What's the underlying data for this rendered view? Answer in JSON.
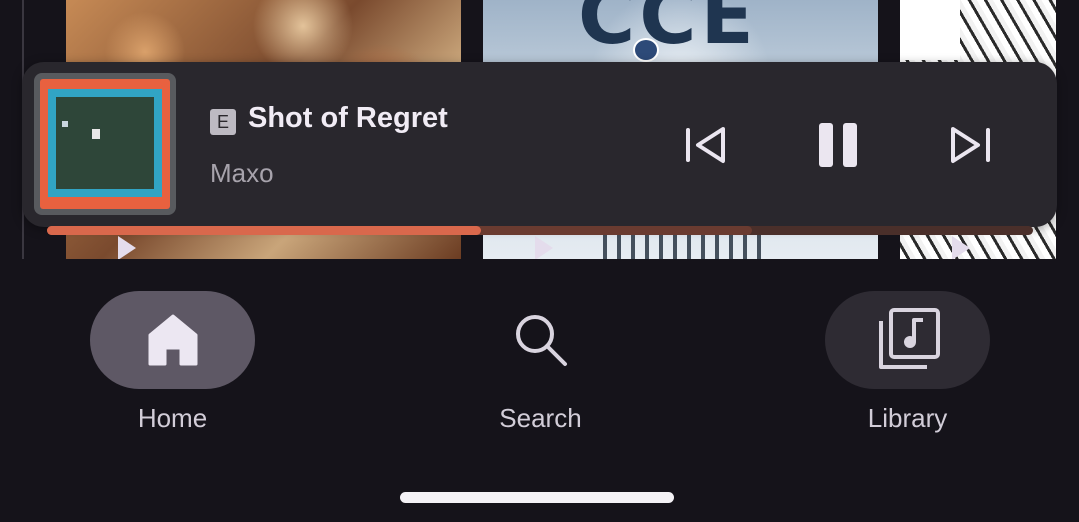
{
  "now_playing": {
    "explicit_badge": "E",
    "title": "Shot of Regret",
    "artist": "Maxo",
    "progress_fraction": 0.44,
    "buffered_fraction": 0.715,
    "controls": {
      "previous_icon": "skip-previous-icon",
      "pause_icon": "pause-icon",
      "next_icon": "skip-next-icon"
    }
  },
  "background_grid": {
    "tile_2_text": "CCE"
  },
  "nav": {
    "items": [
      {
        "label": "Home",
        "icon": "home-icon",
        "selected": true
      },
      {
        "label": "Search",
        "icon": "search-icon",
        "selected": false
      },
      {
        "label": "Library",
        "icon": "library-music-icon",
        "selected": false
      }
    ]
  },
  "colors": {
    "background": "#15131a",
    "player_surface": "#29272d",
    "progress_accent": "#d9684c",
    "nav_selected": "#5e5865"
  }
}
